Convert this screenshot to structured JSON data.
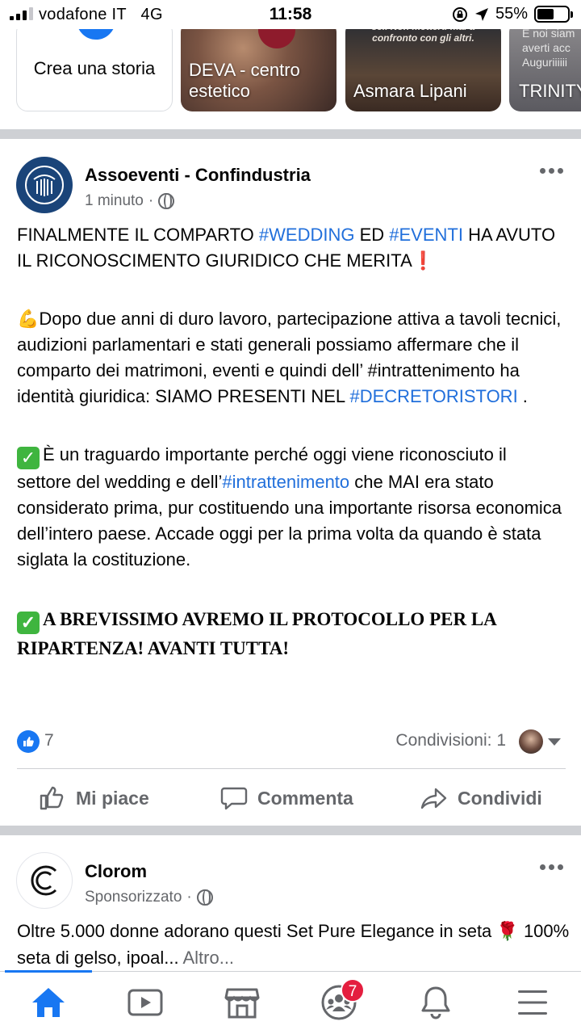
{
  "status_bar": {
    "carrier": "vodafone IT",
    "network": "4G",
    "time": "11:58",
    "battery": "55%",
    "battery_level": 0.55
  },
  "stories": {
    "create_label": "Crea una storia",
    "items": [
      {
        "name": "DEVA - centro estetico"
      },
      {
        "name": "Asmara Lipani",
        "overlay_text": "sei. Non metterti mai a confronto con gli altri."
      },
      {
        "name": "TRINITY",
        "overlay_text": "E noi siam averti acc Auguriiiiii"
      }
    ]
  },
  "post": {
    "author": "Assoeventi - Confindustria",
    "time": "1 minuto",
    "p1_a": "FINALMENTE IL COMPARTO ",
    "tag_wedding": "#WEDDING",
    "p1_b": " ED ",
    "tag_eventi": "#EVENTI",
    "p1_c": " HA AVUTO IL RICONOSCIMENTO GIURIDICO CHE MERITA",
    "p1_excl": "❗",
    "p2_emoji": "💪",
    "p2_a": "Dopo due anni di duro lavoro, partecipazione attiva a tavoli tecnici, audizioni parlamentari e stati generali possiamo affermare che il comparto dei matrimoni, eventi e quindi dell’ #intrattenimento ha identità giuridica: SIAMO PRESENTI NEL ",
    "tag_decreto": "#DECRETORISTORI",
    "p2_b": " .",
    "p3_check": "✓",
    "p3_a": "È un traguardo importante perché oggi viene riconosciuto il settore del wedding e dell’",
    "tag_intratt": "#intrattenimento",
    "p3_b": " che MAI era stato considerato prima, pur costituendo una importante risorsa economica dell’intero paese. Accade oggi per la prima volta da quando è stata siglata la costituzione.",
    "p4_check": "✓",
    "p4_a": "A BREVISSIMO AVREMO IL PROTOCOLLO PER LA RIPARTENZA! AVANTI TUTTA!",
    "likes": "7",
    "shares": "Condivisioni: 1",
    "actions": {
      "like": "Mi piace",
      "comment": "Commenta",
      "share": "Condividi"
    }
  },
  "sponsored": {
    "author": "Clorom",
    "meta": "Sponsorizzato",
    "text_a": "Oltre 5.000 donne adorano questi Set Pure Elegance in seta ",
    "rose": "🌹",
    "text_b": " 100% seta di gelso, ipoal...",
    "more": " Altro..."
  },
  "tab_bar": {
    "groups_badge": "7",
    "icons": [
      "home-icon",
      "video-icon",
      "marketplace-icon",
      "groups-icon",
      "bell-icon",
      "menu-icon"
    ]
  },
  "colors": {
    "accent": "#1877f2",
    "hashtag": "#216fdb",
    "badge": "#e41e3f",
    "muted": "#65676b"
  }
}
